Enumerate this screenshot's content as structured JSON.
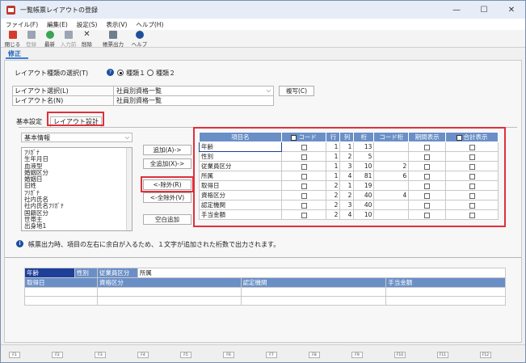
{
  "window": {
    "title": "一覧帳票レイアウトの登録",
    "minimize": "—",
    "maximize": "☐",
    "close": "✕"
  },
  "menu": [
    "ファイル(F)",
    "編集(E)",
    "設定(S)",
    "表示(V)",
    "ヘルプ(H)"
  ],
  "toolbar": [
    {
      "label": "閉じる",
      "icon": "close-door-icon",
      "color": "#d43b2f",
      "enabled": true
    },
    {
      "label": "登録",
      "icon": "save-icon",
      "color": "#9aa5b5",
      "enabled": false
    },
    {
      "label": "最新",
      "icon": "refresh-icon",
      "color": "#3aa655",
      "enabled": true
    },
    {
      "label": "入力前",
      "icon": "undo-icon",
      "color": "#9aa5b5",
      "enabled": false
    },
    {
      "label": "削除",
      "icon": "delete-x-icon",
      "color": "#222222",
      "enabled": true
    },
    {
      "label": "帳票出力",
      "icon": "print-icon",
      "color": "#6f7d8f",
      "enabled": true
    },
    {
      "label": "ヘルプ",
      "icon": "help-icon",
      "color": "#1e4f9c",
      "enabled": true
    }
  ],
  "mode_tab": "修正",
  "layout_type": {
    "label": "レイアウト種類の選択(T)",
    "option1": "種類１",
    "option2": "種類２",
    "selected": 1
  },
  "layout_select": {
    "label": "レイアウト選択(L)",
    "value": "社員別資格一覧"
  },
  "layout_name": {
    "label": "レイアウト名(N)",
    "value": "社員別資格一覧"
  },
  "copy_button": "複写(C)",
  "tabs": {
    "basic": "基本設定",
    "layout": "レイアウト設計"
  },
  "category_select": "基本情報",
  "field_list": [
    "ﾌﾘｶﾞﾅ",
    "生年月日",
    "血液型",
    "婚姻区分",
    "婚姻日",
    "旧姓",
    "ﾌﾘｶﾞﾅ",
    "社内氏名",
    "社内氏名ﾌﾘｶﾞﾅ",
    "国籍区分",
    "世帯主",
    "出身地1"
  ],
  "buttons": {
    "add": "追加(A)->",
    "add_all": "全追加(X)->",
    "remove": "<-除外(R)",
    "remove_all": "<-全除外(V)",
    "add_blank": "空白追加"
  },
  "grid": {
    "headers": {
      "name": "項目名",
      "code": "コード",
      "row": "行",
      "col": "列",
      "digits": "桁",
      "code_digits": "コード桁",
      "period": "期間表示",
      "total": "合計表示"
    },
    "rows": [
      {
        "name": "年齢",
        "row": "1",
        "col": "1",
        "digits": "13",
        "code_digits": ""
      },
      {
        "name": "性別",
        "row": "1",
        "col": "2",
        "digits": "5",
        "code_digits": ""
      },
      {
        "name": "従業員区分",
        "row": "1",
        "col": "3",
        "digits": "10",
        "code_digits": "2"
      },
      {
        "name": "所属",
        "row": "1",
        "col": "4",
        "digits": "81",
        "code_digits": "6"
      },
      {
        "name": "取得日",
        "row": "2",
        "col": "1",
        "digits": "19",
        "code_digits": ""
      },
      {
        "name": "資格区分",
        "row": "2",
        "col": "2",
        "digits": "40",
        "code_digits": "4"
      },
      {
        "name": "認定機関",
        "row": "2",
        "col": "3",
        "digits": "40",
        "code_digits": ""
      },
      {
        "name": "手当金額",
        "row": "2",
        "col": "4",
        "digits": "10",
        "code_digits": ""
      }
    ]
  },
  "info_text": "帳票出力時、項目の左右に余白が入るため、１文字が追加された桁数で出力されます。",
  "preview": {
    "row1": [
      "年齢",
      "性別",
      "従業員区分",
      "所属"
    ],
    "row2": [
      "取得日",
      "資格区分",
      "認定機関",
      "手当金額"
    ]
  },
  "function_keys": [
    "F1",
    "F2",
    "F3",
    "F4",
    "F5",
    "F6",
    "F7",
    "F8",
    "F9",
    "F10",
    "F11",
    "F12"
  ],
  "colors": {
    "header_blue": "#6a8fc7",
    "preview_dark": "#1e3f99",
    "highlight_red": "#e0303a"
  }
}
